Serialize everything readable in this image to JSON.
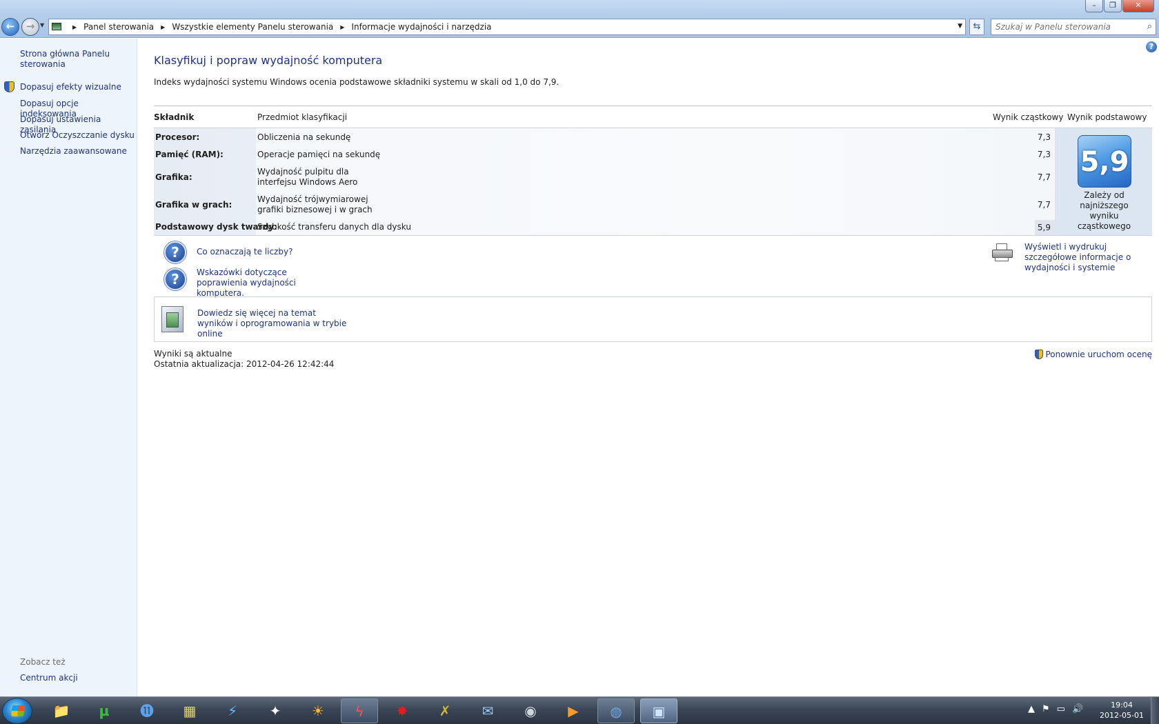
{
  "window": {
    "minimize": "–",
    "maximize": "❐",
    "close": "✕"
  },
  "nav": {
    "back": "←",
    "forward": "→"
  },
  "breadcrumb": [
    "Panel sterowania",
    "Wszystkie elementy Panelu sterowania",
    "Informacje wydajności i narzędzia"
  ],
  "search": {
    "placeholder": "Szukaj w Panelu sterowania"
  },
  "sidebar": {
    "items": [
      {
        "label": "Strona główna Panelu sterowania",
        "shield": false
      },
      {
        "label": "Dopasuj efekty wizualne",
        "shield": true
      },
      {
        "label": "Dopasuj opcje indeksowania",
        "shield": false
      },
      {
        "label": "Dopasuj ustawienia zasilania",
        "shield": false
      },
      {
        "label": "Otwórz Oczyszczanie dysku",
        "shield": false
      },
      {
        "label": "Narzędzia zaawansowane",
        "shield": false
      }
    ],
    "see_also": "Zobacz też",
    "see_also_items": [
      "Centrum akcji"
    ]
  },
  "main": {
    "title": "Klasyfikuj i popraw wydajność komputera",
    "intro": "Indeks wydajności systemu Windows ocenia podstawowe składniki systemu w skali od 1,0 do 7,9.",
    "table": {
      "headers": [
        "Składnik",
        "Przedmiot klasyfikacji",
        "Wynik cząstkowy",
        "Wynik podstawowy"
      ],
      "rows": [
        {
          "component": "Procesor:",
          "subject": "Obliczenia na sekundę",
          "score": "7,3"
        },
        {
          "component": "Pamięć (RAM):",
          "subject": "Operacje pamięci na sekundę",
          "score": "7,3"
        },
        {
          "component": "Grafika:",
          "subject": "Wydajność pulpitu dla interfejsu Windows Aero",
          "score": "7,7"
        },
        {
          "component": "Grafika w grach:",
          "subject": "Wydajność trójwymiarowej grafiki biznesowej i w grach",
          "score": "7,7"
        },
        {
          "component": "Podstawowy dysk twardy:",
          "subject": "Szybkość transferu danych dla dysku",
          "score": "5,9"
        }
      ],
      "base_score": "5,9",
      "base_note": "Zależy od najniższego wyniku cząstkowego"
    },
    "links": {
      "what_numbers": "Co oznaczają te liczby?",
      "tips": "Wskazówki dotyczące poprawienia wydajności komputera.",
      "print": "Wyświetl i wydrukuj szczegółowe informacje o wydajności i systemie",
      "online": "Dowiedz się więcej na temat wyników i oprogramowania w trybie online",
      "rerun": "Ponownie uruchom ocenę"
    },
    "status": {
      "current": "Wyniki są aktualne",
      "last_update": "Ostatnia aktualizacja: 2012-04-26 12:42:44"
    }
  },
  "taskbar": {
    "items": [
      {
        "name": "explorer",
        "glyph": "📁"
      },
      {
        "name": "utorrent",
        "glyph": "µ"
      },
      {
        "name": "app-11",
        "glyph": "⓫"
      },
      {
        "name": "film-strip",
        "glyph": "▦"
      },
      {
        "name": "thunderbolt",
        "glyph": "⚡"
      },
      {
        "name": "foxy",
        "glyph": "✦"
      },
      {
        "name": "sun",
        "glyph": "☀"
      },
      {
        "name": "flash",
        "glyph": "ϟ"
      },
      {
        "name": "splat",
        "glyph": "✸"
      },
      {
        "name": "x-app",
        "glyph": "✗"
      },
      {
        "name": "mail",
        "glyph": "✉"
      },
      {
        "name": "steam",
        "glyph": "◉"
      },
      {
        "name": "media",
        "glyph": "▶"
      },
      {
        "name": "globe",
        "glyph": "◍"
      },
      {
        "name": "control-panel",
        "glyph": "▣"
      }
    ],
    "tray": [
      "▲",
      "⚑",
      "▭",
      "🔊"
    ],
    "time": "19:04",
    "date": "2012-05-01"
  }
}
